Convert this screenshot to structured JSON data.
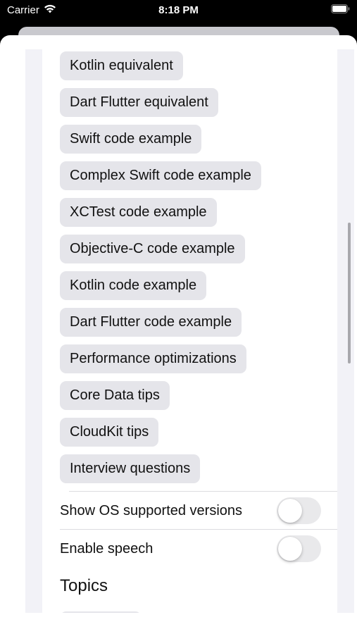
{
  "status_bar": {
    "carrier": "Carrier",
    "time": "8:18 PM",
    "wifi_icon": "wifi-icon",
    "battery_icon": "battery-icon"
  },
  "options": [
    "Kotlin equivalent",
    "Dart Flutter equivalent",
    "Swift code example",
    "Complex Swift code example",
    "XCTest code example",
    "Objective-C code example",
    "Kotlin code example",
    "Dart Flutter code example",
    "Performance optimizations",
    "Core Data tips",
    "CloudKit tips",
    "Interview questions"
  ],
  "settings": {
    "show_os_versions": {
      "label": "Show OS supported versions",
      "enabled": false
    },
    "enable_speech": {
      "label": "Enable speech",
      "enabled": false
    }
  },
  "topics": {
    "title": "Topics"
  },
  "colors": {
    "chip_bg": "#e5e5ea",
    "toggle_off": "#e9e9eb",
    "sheet_bg": "#ffffff"
  }
}
